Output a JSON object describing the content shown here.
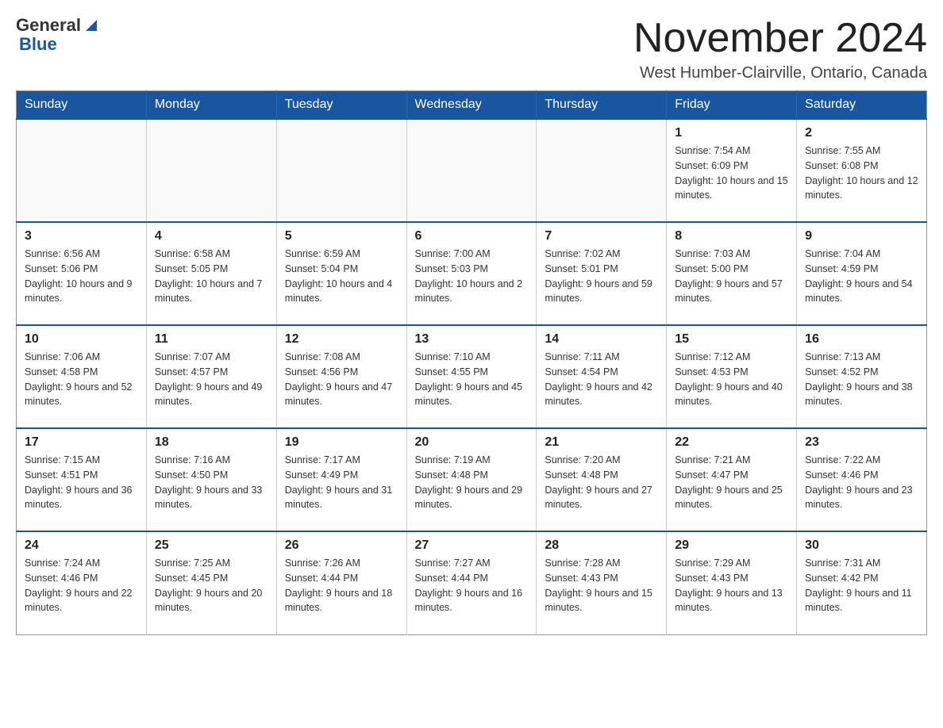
{
  "header": {
    "logo_general": "General",
    "logo_blue": "Blue",
    "month_title": "November 2024",
    "location": "West Humber-Clairville, Ontario, Canada"
  },
  "weekdays": [
    "Sunday",
    "Monday",
    "Tuesday",
    "Wednesday",
    "Thursday",
    "Friday",
    "Saturday"
  ],
  "weeks": [
    [
      {
        "day": "",
        "sunrise": "",
        "sunset": "",
        "daylight": ""
      },
      {
        "day": "",
        "sunrise": "",
        "sunset": "",
        "daylight": ""
      },
      {
        "day": "",
        "sunrise": "",
        "sunset": "",
        "daylight": ""
      },
      {
        "day": "",
        "sunrise": "",
        "sunset": "",
        "daylight": ""
      },
      {
        "day": "",
        "sunrise": "",
        "sunset": "",
        "daylight": ""
      },
      {
        "day": "1",
        "sunrise": "Sunrise: 7:54 AM",
        "sunset": "Sunset: 6:09 PM",
        "daylight": "Daylight: 10 hours and 15 minutes."
      },
      {
        "day": "2",
        "sunrise": "Sunrise: 7:55 AM",
        "sunset": "Sunset: 6:08 PM",
        "daylight": "Daylight: 10 hours and 12 minutes."
      }
    ],
    [
      {
        "day": "3",
        "sunrise": "Sunrise: 6:56 AM",
        "sunset": "Sunset: 5:06 PM",
        "daylight": "Daylight: 10 hours and 9 minutes."
      },
      {
        "day": "4",
        "sunrise": "Sunrise: 6:58 AM",
        "sunset": "Sunset: 5:05 PM",
        "daylight": "Daylight: 10 hours and 7 minutes."
      },
      {
        "day": "5",
        "sunrise": "Sunrise: 6:59 AM",
        "sunset": "Sunset: 5:04 PM",
        "daylight": "Daylight: 10 hours and 4 minutes."
      },
      {
        "day": "6",
        "sunrise": "Sunrise: 7:00 AM",
        "sunset": "Sunset: 5:03 PM",
        "daylight": "Daylight: 10 hours and 2 minutes."
      },
      {
        "day": "7",
        "sunrise": "Sunrise: 7:02 AM",
        "sunset": "Sunset: 5:01 PM",
        "daylight": "Daylight: 9 hours and 59 minutes."
      },
      {
        "day": "8",
        "sunrise": "Sunrise: 7:03 AM",
        "sunset": "Sunset: 5:00 PM",
        "daylight": "Daylight: 9 hours and 57 minutes."
      },
      {
        "day": "9",
        "sunrise": "Sunrise: 7:04 AM",
        "sunset": "Sunset: 4:59 PM",
        "daylight": "Daylight: 9 hours and 54 minutes."
      }
    ],
    [
      {
        "day": "10",
        "sunrise": "Sunrise: 7:06 AM",
        "sunset": "Sunset: 4:58 PM",
        "daylight": "Daylight: 9 hours and 52 minutes."
      },
      {
        "day": "11",
        "sunrise": "Sunrise: 7:07 AM",
        "sunset": "Sunset: 4:57 PM",
        "daylight": "Daylight: 9 hours and 49 minutes."
      },
      {
        "day": "12",
        "sunrise": "Sunrise: 7:08 AM",
        "sunset": "Sunset: 4:56 PM",
        "daylight": "Daylight: 9 hours and 47 minutes."
      },
      {
        "day": "13",
        "sunrise": "Sunrise: 7:10 AM",
        "sunset": "Sunset: 4:55 PM",
        "daylight": "Daylight: 9 hours and 45 minutes."
      },
      {
        "day": "14",
        "sunrise": "Sunrise: 7:11 AM",
        "sunset": "Sunset: 4:54 PM",
        "daylight": "Daylight: 9 hours and 42 minutes."
      },
      {
        "day": "15",
        "sunrise": "Sunrise: 7:12 AM",
        "sunset": "Sunset: 4:53 PM",
        "daylight": "Daylight: 9 hours and 40 minutes."
      },
      {
        "day": "16",
        "sunrise": "Sunrise: 7:13 AM",
        "sunset": "Sunset: 4:52 PM",
        "daylight": "Daylight: 9 hours and 38 minutes."
      }
    ],
    [
      {
        "day": "17",
        "sunrise": "Sunrise: 7:15 AM",
        "sunset": "Sunset: 4:51 PM",
        "daylight": "Daylight: 9 hours and 36 minutes."
      },
      {
        "day": "18",
        "sunrise": "Sunrise: 7:16 AM",
        "sunset": "Sunset: 4:50 PM",
        "daylight": "Daylight: 9 hours and 33 minutes."
      },
      {
        "day": "19",
        "sunrise": "Sunrise: 7:17 AM",
        "sunset": "Sunset: 4:49 PM",
        "daylight": "Daylight: 9 hours and 31 minutes."
      },
      {
        "day": "20",
        "sunrise": "Sunrise: 7:19 AM",
        "sunset": "Sunset: 4:48 PM",
        "daylight": "Daylight: 9 hours and 29 minutes."
      },
      {
        "day": "21",
        "sunrise": "Sunrise: 7:20 AM",
        "sunset": "Sunset: 4:48 PM",
        "daylight": "Daylight: 9 hours and 27 minutes."
      },
      {
        "day": "22",
        "sunrise": "Sunrise: 7:21 AM",
        "sunset": "Sunset: 4:47 PM",
        "daylight": "Daylight: 9 hours and 25 minutes."
      },
      {
        "day": "23",
        "sunrise": "Sunrise: 7:22 AM",
        "sunset": "Sunset: 4:46 PM",
        "daylight": "Daylight: 9 hours and 23 minutes."
      }
    ],
    [
      {
        "day": "24",
        "sunrise": "Sunrise: 7:24 AM",
        "sunset": "Sunset: 4:46 PM",
        "daylight": "Daylight: 9 hours and 22 minutes."
      },
      {
        "day": "25",
        "sunrise": "Sunrise: 7:25 AM",
        "sunset": "Sunset: 4:45 PM",
        "daylight": "Daylight: 9 hours and 20 minutes."
      },
      {
        "day": "26",
        "sunrise": "Sunrise: 7:26 AM",
        "sunset": "Sunset: 4:44 PM",
        "daylight": "Daylight: 9 hours and 18 minutes."
      },
      {
        "day": "27",
        "sunrise": "Sunrise: 7:27 AM",
        "sunset": "Sunset: 4:44 PM",
        "daylight": "Daylight: 9 hours and 16 minutes."
      },
      {
        "day": "28",
        "sunrise": "Sunrise: 7:28 AM",
        "sunset": "Sunset: 4:43 PM",
        "daylight": "Daylight: 9 hours and 15 minutes."
      },
      {
        "day": "29",
        "sunrise": "Sunrise: 7:29 AM",
        "sunset": "Sunset: 4:43 PM",
        "daylight": "Daylight: 9 hours and 13 minutes."
      },
      {
        "day": "30",
        "sunrise": "Sunrise: 7:31 AM",
        "sunset": "Sunset: 4:42 PM",
        "daylight": "Daylight: 9 hours and 11 minutes."
      }
    ]
  ]
}
